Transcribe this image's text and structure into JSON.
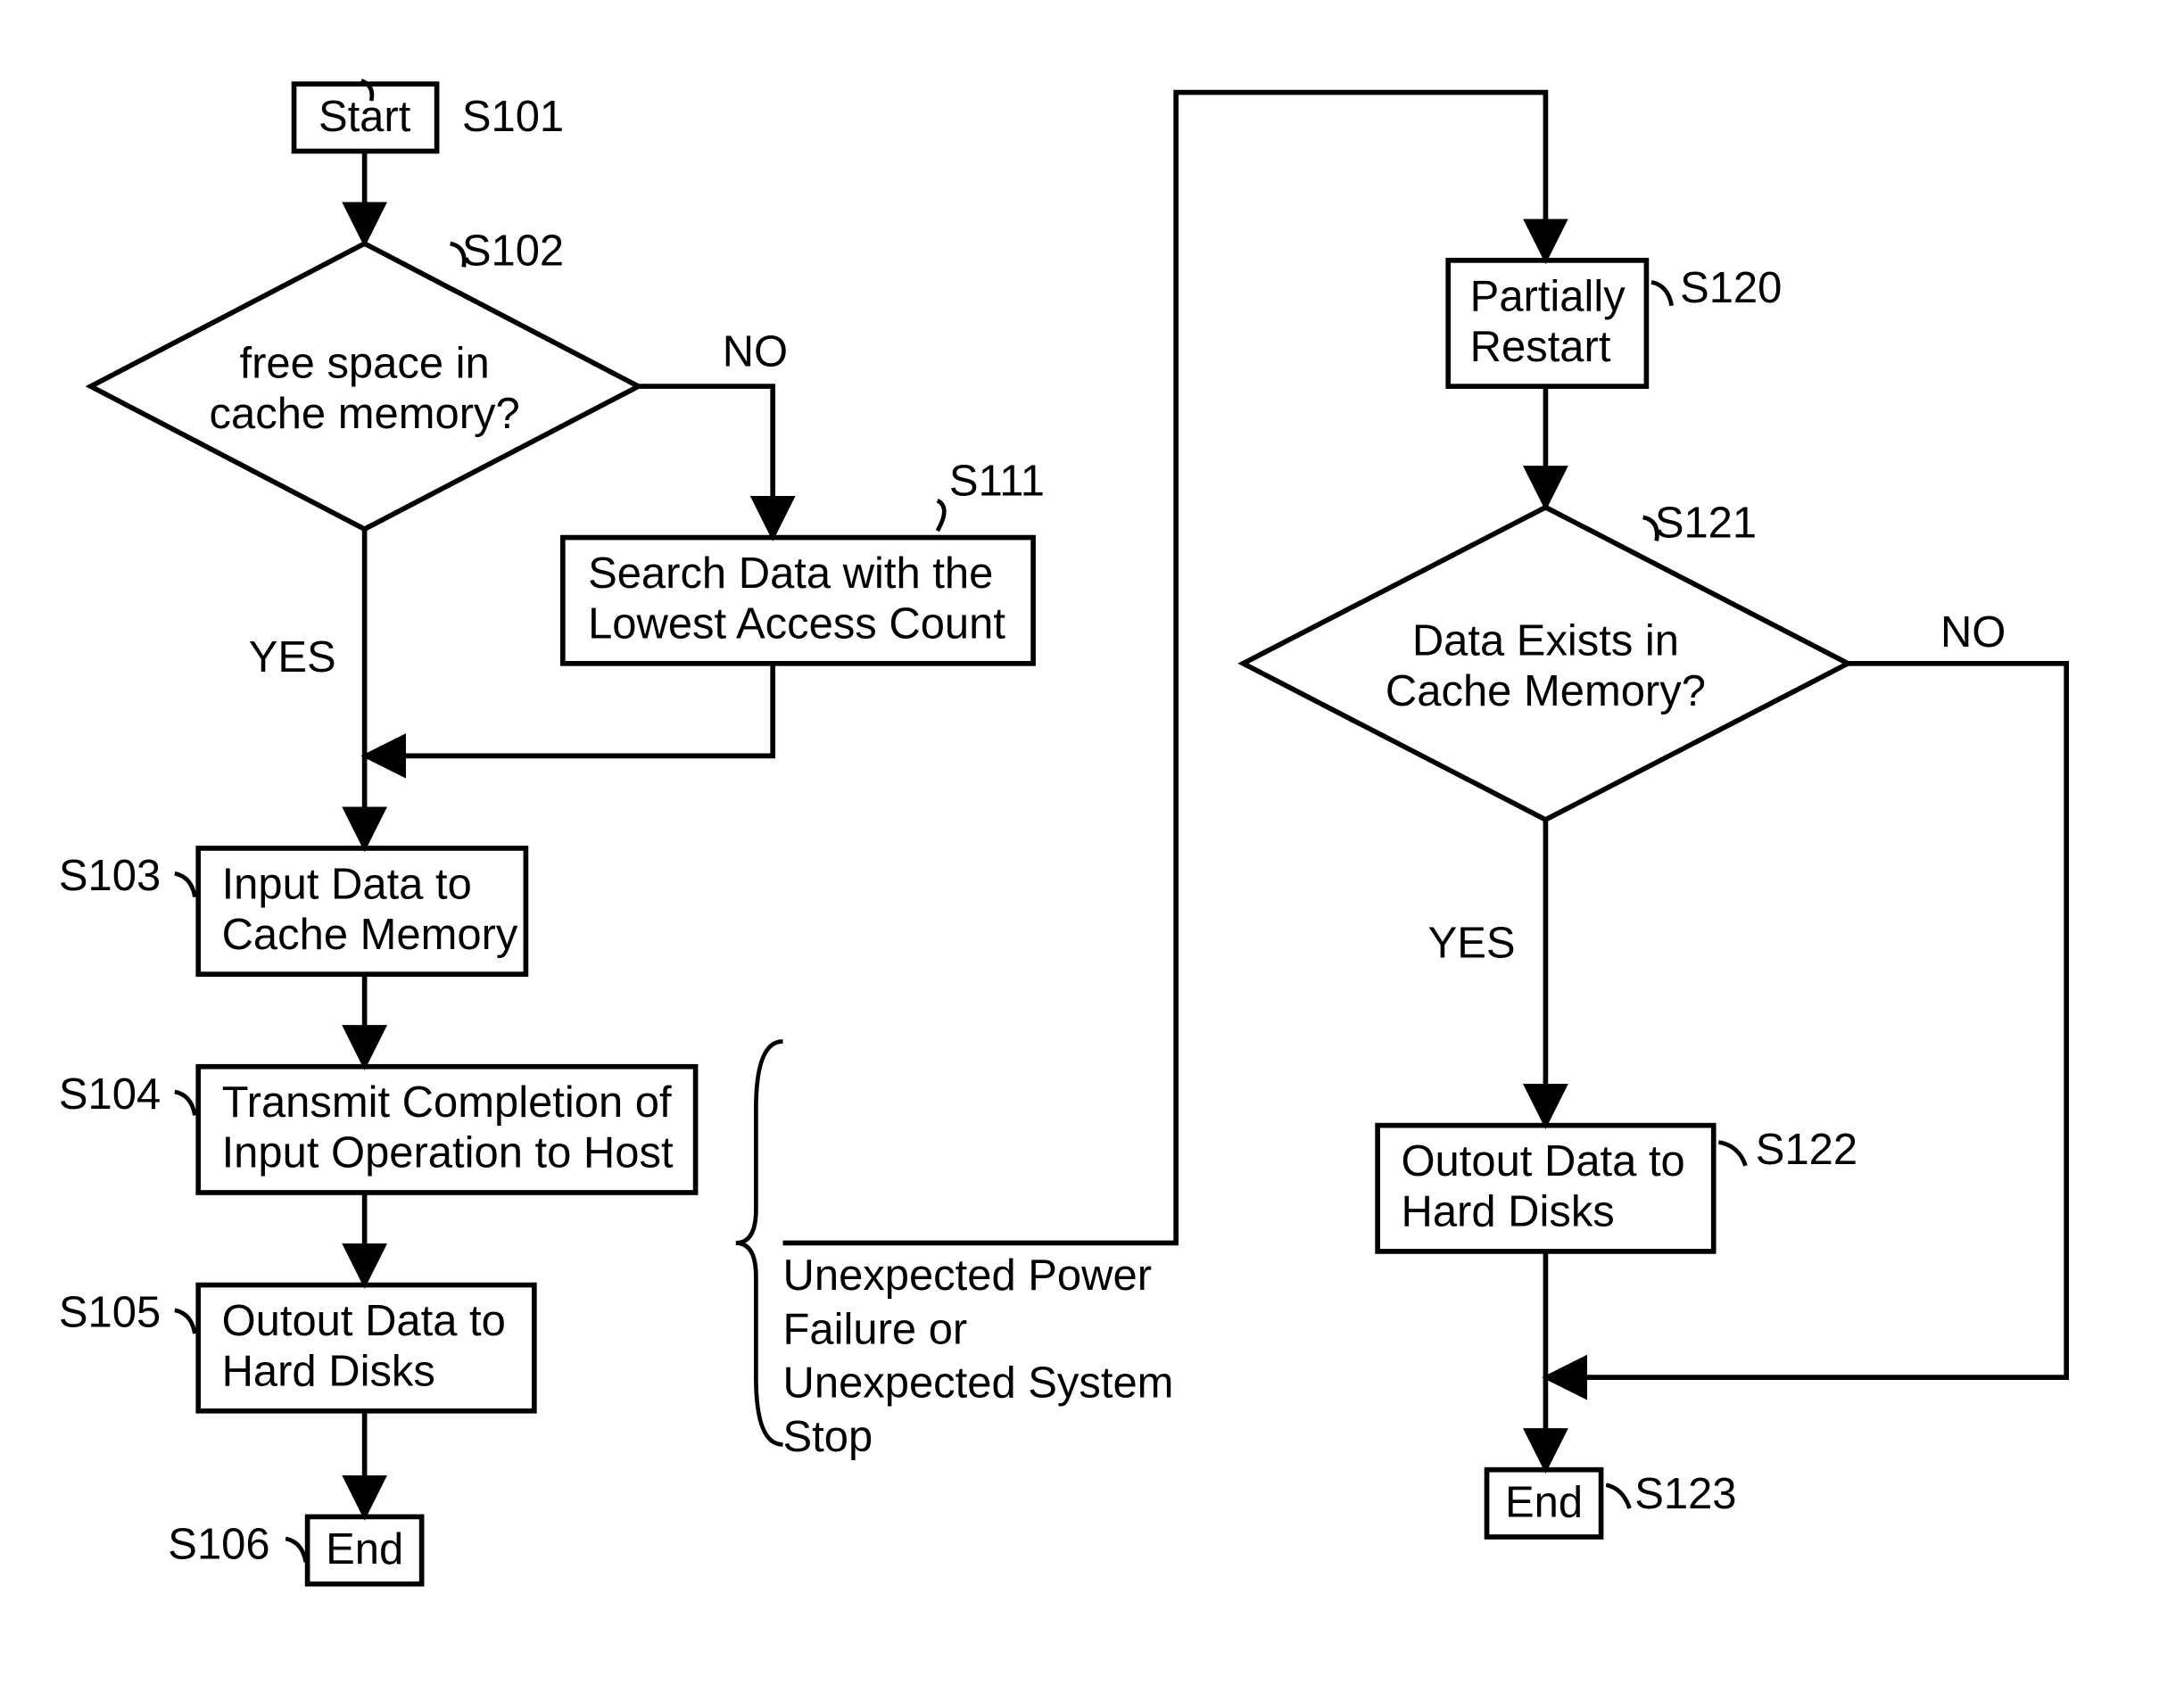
{
  "nodes": {
    "s101": {
      "text": "Start",
      "step": "S101"
    },
    "s102": {
      "text1": "free space in",
      "text2": "cache memory?",
      "step": "S102",
      "no": "NO",
      "yes": "YES"
    },
    "s111": {
      "text1": "Search Data with the",
      "text2": "Lowest Access Count",
      "step": "S111"
    },
    "s103": {
      "text1": "Input Data to",
      "text2": "Cache Memory",
      "step": "S103"
    },
    "s104": {
      "text1": "Transmit Completion of",
      "text2": "Input Operation to Host",
      "step": "S104"
    },
    "s105": {
      "text1": "Outout Data to",
      "text2": "Hard Disks",
      "step": "S105"
    },
    "s106": {
      "text": "End",
      "step": "S106"
    },
    "s120": {
      "text1": "Partially",
      "text2": "Restart",
      "step": "S120"
    },
    "s121": {
      "text1": "Data Exists in",
      "text2": "Cache Memory?",
      "step": "S121",
      "no": "NO",
      "yes": "YES"
    },
    "s122": {
      "text1": "Outout Data to",
      "text2": "Hard Disks",
      "step": "S122"
    },
    "s123": {
      "text": "End",
      "step": "S123"
    }
  },
  "annotations": {
    "failure1": "Unexpected Power",
    "failure2": "Failure or",
    "failure3": "Unexpected System",
    "failure4": "Stop"
  }
}
